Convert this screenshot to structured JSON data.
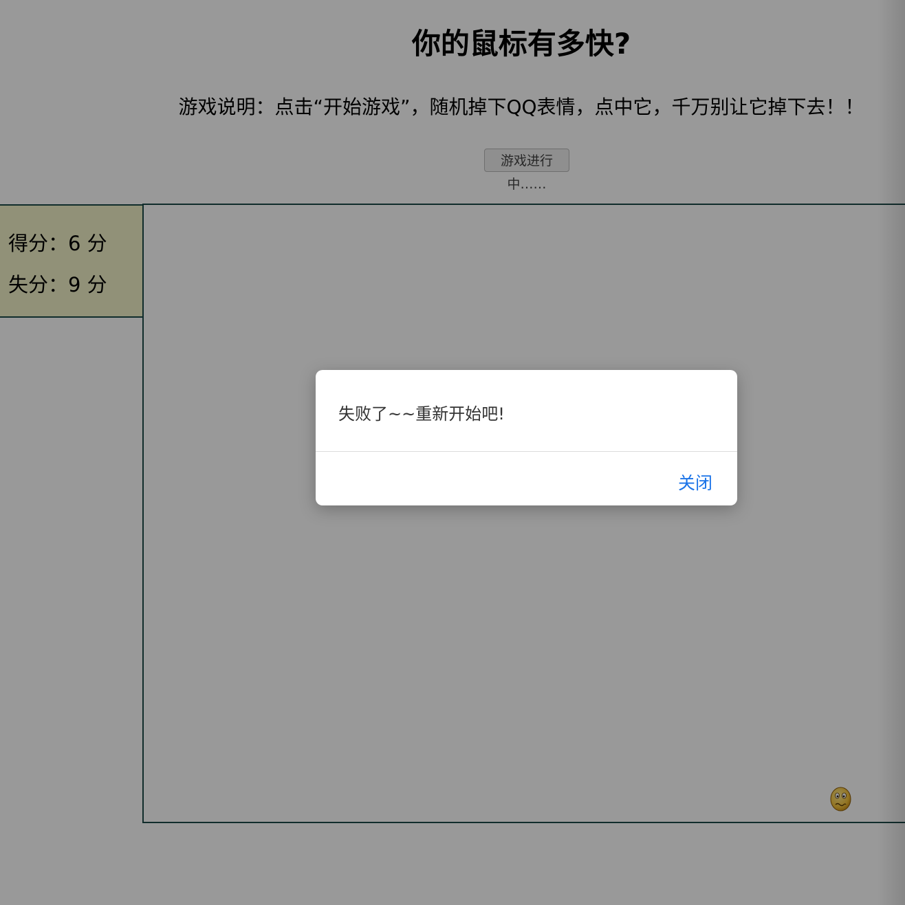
{
  "header": {
    "title": "你的鼠标有多快?",
    "instructions": "游戏说明：点击“开始游戏”，随机掉下QQ表情，点中它，千万别让它掉下去！！",
    "status_button": "游戏进行中……"
  },
  "scoreboard": {
    "hit_text": "得分：6 分",
    "miss_text": "失分：9 分",
    "hit": 6,
    "miss": 9
  },
  "game": {
    "falling_emoji": "qq-face-icon"
  },
  "dialog": {
    "message": "失败了~~重新开始吧!",
    "close_label": "关闭"
  },
  "colors": {
    "score_panel": "#f2f2c8",
    "border": "#1b4a48",
    "link": "#1a73e8"
  }
}
